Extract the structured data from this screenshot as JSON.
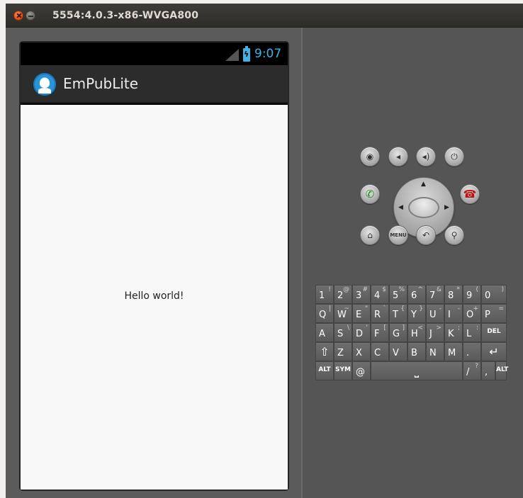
{
  "window": {
    "title": "5554:4.0.3-x86-WVGA800"
  },
  "status_bar": {
    "time": "9:07"
  },
  "action_bar": {
    "app_title": "EmPubLite"
  },
  "content": {
    "text": "Hello world!"
  },
  "controls": {
    "row1": [
      "camera-icon",
      "volume-down-icon",
      "volume-up-icon",
      "power-icon"
    ],
    "row2": [
      "call-icon",
      "dpad",
      "end-call-icon"
    ],
    "row3": [
      "home-icon",
      "menu-icon",
      "back-icon",
      "search-icon"
    ],
    "menu_label": "MENU"
  },
  "keyboard": {
    "row1": [
      {
        "main": "1",
        "alt": "!"
      },
      {
        "main": "2",
        "alt": "@"
      },
      {
        "main": "3",
        "alt": "#"
      },
      {
        "main": "4",
        "alt": "$"
      },
      {
        "main": "5",
        "alt": "%"
      },
      {
        "main": "6",
        "alt": "^"
      },
      {
        "main": "7",
        "alt": "&"
      },
      {
        "main": "8",
        "alt": "*"
      },
      {
        "main": "9",
        "alt": "("
      },
      {
        "main": "0",
        "alt": ")"
      }
    ],
    "row2": [
      {
        "main": "Q",
        "alt": "|"
      },
      {
        "main": "W",
        "alt": "~"
      },
      {
        "main": "E",
        "alt": "\""
      },
      {
        "main": "R",
        "alt": "`"
      },
      {
        "main": "T",
        "alt": "{"
      },
      {
        "main": "Y",
        "alt": "}"
      },
      {
        "main": "U",
        "alt": "-"
      },
      {
        "main": "I",
        "alt": "-"
      },
      {
        "main": "O",
        "alt": "+"
      },
      {
        "main": "P",
        "alt": "="
      }
    ],
    "row3": [
      {
        "main": "A",
        "alt": ""
      },
      {
        "main": "S",
        "alt": "\\"
      },
      {
        "main": "D",
        "alt": "'"
      },
      {
        "main": "F",
        "alt": "["
      },
      {
        "main": "G",
        "alt": "]"
      },
      {
        "main": "H",
        "alt": "<"
      },
      {
        "main": "J",
        "alt": ">"
      },
      {
        "main": "K",
        "alt": ";"
      },
      {
        "main": "L",
        "alt": ":"
      },
      {
        "main": "DEL",
        "alt": ""
      }
    ],
    "row4": [
      {
        "main": "⇧",
        "alt": ""
      },
      {
        "main": "Z",
        "alt": ""
      },
      {
        "main": "X",
        "alt": ""
      },
      {
        "main": "C",
        "alt": ""
      },
      {
        "main": "V",
        "alt": ""
      },
      {
        "main": "B",
        "alt": ""
      },
      {
        "main": "N",
        "alt": ""
      },
      {
        "main": "M",
        "alt": ""
      },
      {
        "main": ".",
        "alt": ""
      },
      {
        "main": "↵",
        "alt": ""
      }
    ],
    "row5": [
      {
        "main": "ALT",
        "alt": ""
      },
      {
        "main": "SYM",
        "alt": ""
      },
      {
        "main": "@",
        "alt": ""
      },
      {
        "main": "⎵",
        "alt": ""
      },
      {
        "main": "/",
        "alt": "?"
      },
      {
        "main": ",",
        "alt": ""
      },
      {
        "main": "ALT",
        "alt": ""
      }
    ]
  }
}
